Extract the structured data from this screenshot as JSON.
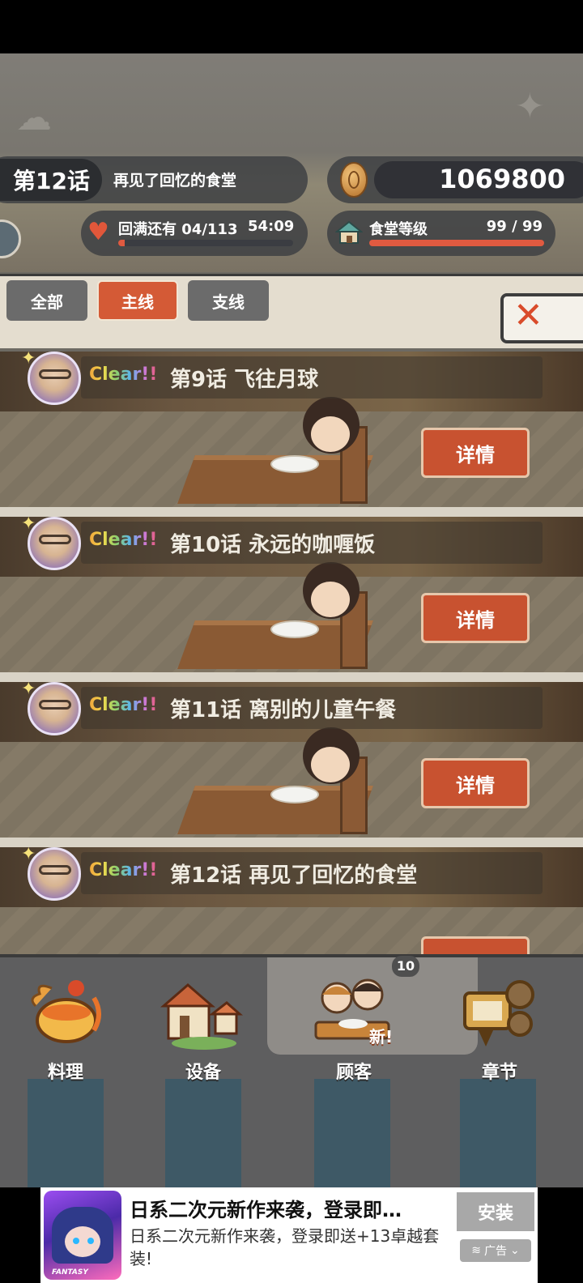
{
  "header": {
    "chapter_no": "第12话",
    "chapter_title": "再见了回忆的食堂",
    "coins": "1069800",
    "stamina_text": "回满还有 04/113",
    "stamina_time": "54:09",
    "stamina_progress": 0.035,
    "level_label": "食堂等级",
    "level_value": "99 / 99",
    "level_progress": 1.0
  },
  "tabs": [
    {
      "label": "全部",
      "active": false
    },
    {
      "label": "主线",
      "active": true
    },
    {
      "label": "支线",
      "active": false
    }
  ],
  "episodes": [
    {
      "clear_label": "Clear!!",
      "title": "第9话   飞往月球",
      "detail_label": "详情"
    },
    {
      "clear_label": "Clear!!",
      "title": "第10话  永远的咖喱饭",
      "detail_label": "详情"
    },
    {
      "clear_label": "Clear!!",
      "title": "第11话  离别的儿童午餐",
      "detail_label": "详情"
    },
    {
      "clear_label": "Clear!!",
      "title": "第12话  再见了回忆的食堂",
      "detail_label": ""
    }
  ],
  "bottom_badge": "10",
  "nav": [
    {
      "label": "料理",
      "icon": "cooking-icon"
    },
    {
      "label": "设备",
      "icon": "facility-icon"
    },
    {
      "label": "顾客",
      "icon": "customers-icon",
      "new_tag": "新!"
    },
    {
      "label": "章节",
      "icon": "chapter-icon"
    }
  ],
  "ad": {
    "title": "日系二次元新作来袭，登录即…",
    "subtitle": "日系二次元新作来袭，登录即送+13卓越套装!",
    "install_label": "安装",
    "tag_label": "广告",
    "brand": "FANTASY"
  },
  "colors": {
    "accent": "#d45a36",
    "detail_button": "#c85230",
    "tab_inactive": "#6b6b6b",
    "nav_column": "#3e5966"
  }
}
